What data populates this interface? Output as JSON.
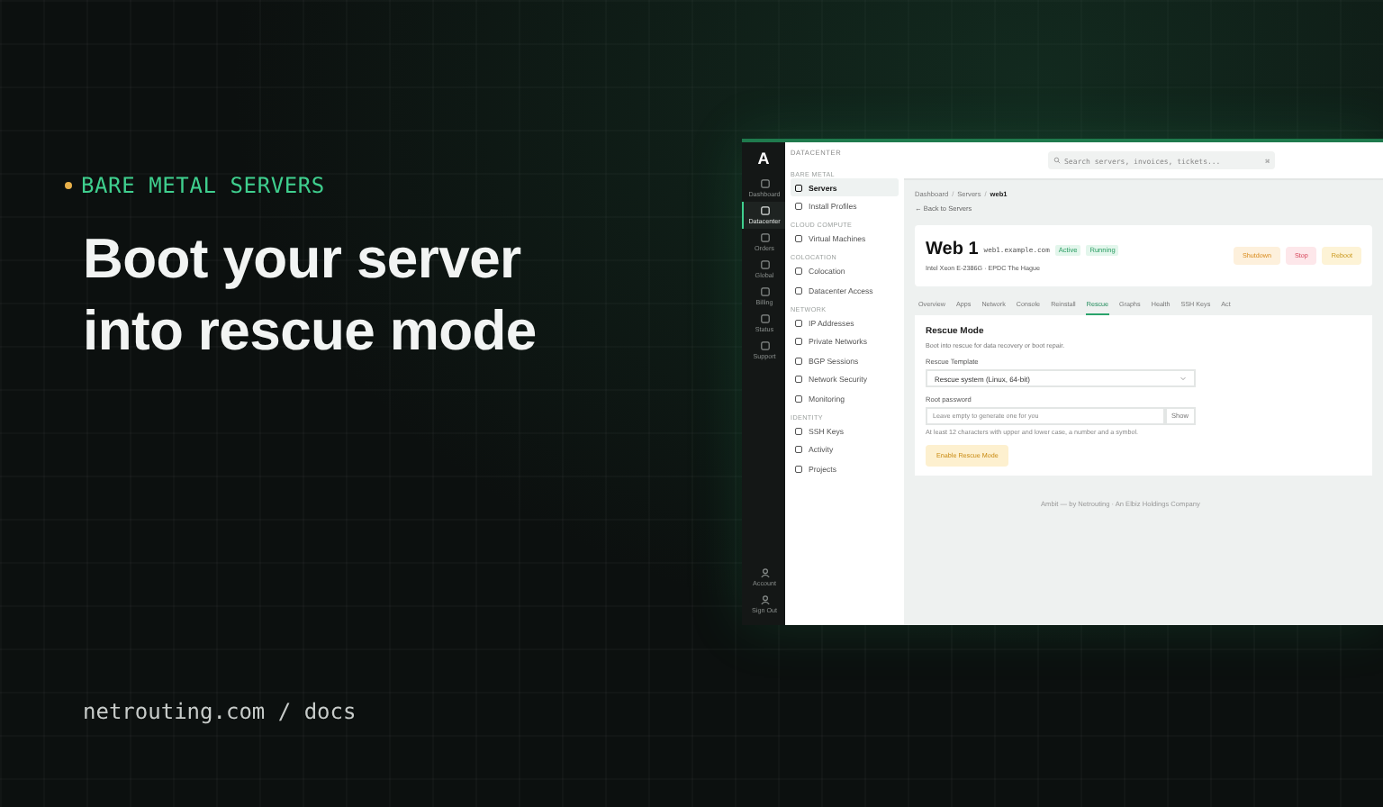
{
  "hero": {
    "eyebrow": "BARE METAL SERVERS",
    "title_lines": [
      "Boot your server",
      "into rescue mode"
    ],
    "footer": "netrouting.com / docs"
  },
  "app": {
    "logo": "A",
    "rail": [
      {
        "label": "Dashboard",
        "selected": false
      },
      {
        "label": "Datacenter",
        "selected": true
      },
      {
        "label": "Orders",
        "selected": false
      },
      {
        "label": "Global",
        "selected": false
      },
      {
        "label": "Billing",
        "selected": false
      },
      {
        "label": "Status",
        "selected": false
      },
      {
        "label": "Support",
        "selected": false
      }
    ],
    "rail_bottom": [
      {
        "label": "Account"
      },
      {
        "label": "Sign Out"
      }
    ],
    "nav": {
      "header": "DATACENTER",
      "sections": [
        {
          "heading": "BARE METAL",
          "items": [
            {
              "label": "Servers",
              "selected": true
            },
            {
              "label": "Install Profiles",
              "selected": false
            }
          ]
        },
        {
          "heading": "CLOUD COMPUTE",
          "items": [
            {
              "label": "Virtual Machines",
              "selected": false
            }
          ]
        },
        {
          "heading": "COLOCATION",
          "items": [
            {
              "label": "Colocation",
              "selected": false
            },
            {
              "label": "Datacenter Access",
              "selected": false
            }
          ]
        },
        {
          "heading": "NETWORK",
          "items": [
            {
              "label": "IP Addresses",
              "selected": false
            },
            {
              "label": "Private Networks",
              "selected": false
            },
            {
              "label": "BGP Sessions",
              "selected": false
            },
            {
              "label": "Network Security",
              "selected": false
            },
            {
              "label": "Monitoring",
              "selected": false
            }
          ]
        },
        {
          "heading": "IDENTITY",
          "items": [
            {
              "label": "SSH Keys",
              "selected": false
            },
            {
              "label": "Activity",
              "selected": false
            },
            {
              "label": "Projects",
              "selected": false
            }
          ]
        }
      ]
    },
    "search": {
      "placeholder": "Search servers, invoices, tickets...",
      "shortcut": "⌘"
    },
    "breadcrumb": [
      "Dashboard",
      "Servers",
      "web1"
    ],
    "breadcrumb_separator": "/",
    "back_link": "← Back to Servers",
    "server": {
      "name": "Web 1",
      "hostname": "web1.example.com",
      "badges": [
        "Active",
        "Running"
      ],
      "specs": "Intel Xeon E-2386G · EPDC The Hague",
      "actions": [
        {
          "label": "Shutdown",
          "kind": "warning"
        },
        {
          "label": "Stop",
          "kind": "danger"
        },
        {
          "label": "Reboot",
          "kind": "caution"
        }
      ]
    },
    "tabs": [
      {
        "label": "Overview",
        "selected": false
      },
      {
        "label": "Apps",
        "selected": false
      },
      {
        "label": "Network",
        "selected": false
      },
      {
        "label": "Console",
        "selected": false
      },
      {
        "label": "Reinstall",
        "selected": false
      },
      {
        "label": "Rescue",
        "selected": true
      },
      {
        "label": "Graphs",
        "selected": false
      },
      {
        "label": "Health",
        "selected": false
      },
      {
        "label": "SSH Keys",
        "selected": false
      },
      {
        "label": "Act",
        "selected": false
      }
    ],
    "rescue": {
      "title": "Rescue Mode",
      "description": "Boot into rescue for data recovery or boot repair.",
      "template_label": "Rescue Template",
      "template_value": "Rescue system (Linux, 64-bit)",
      "password_label": "Root password",
      "password_placeholder": "Leave empty to generate one for you",
      "show_button": "Show",
      "hint": "At least 12 characters with upper and lower case, a number and a symbol.",
      "submit": "Enable Rescue Mode"
    },
    "footer": "Ambit — by Netrouting · An Elbiz Holdings Company"
  }
}
